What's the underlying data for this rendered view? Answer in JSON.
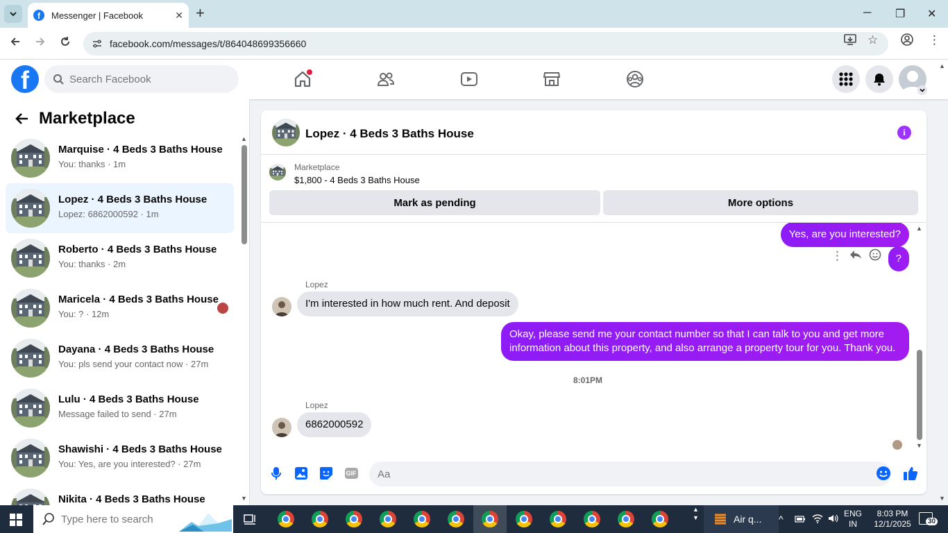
{
  "browser": {
    "tab_title": "Messenger | Facebook",
    "url": "facebook.com/messages/t/864048699356660"
  },
  "fb": {
    "search_placeholder": "Search Facebook"
  },
  "left_panel": {
    "title": "Marketplace",
    "conversations": [
      {
        "name": "Marquise · 4 Beds 3 Baths House",
        "preview": "You: thanks · 1m"
      },
      {
        "name": "Lopez · 4 Beds 3 Baths House",
        "preview": "Lopez: 6862000592 · 1m"
      },
      {
        "name": "Roberto · 4 Beds 3 Baths House",
        "preview": "You: thanks · 2m"
      },
      {
        "name": "Maricela · 4 Beds 3 Baths House",
        "preview": "You: ? · 12m"
      },
      {
        "name": "Dayana · 4 Beds 3 Baths House",
        "preview": "You: pls send your contact now · 27m"
      },
      {
        "name": "Lulu · 4 Beds 3 Baths House",
        "preview": "Message failed to send · 27m"
      },
      {
        "name": "Shawishi · 4 Beds 3 Baths House",
        "preview": "You: Yes, are you interested? · 27m"
      },
      {
        "name": "Nikita · 4 Beds 3 Baths House",
        "preview": ""
      }
    ]
  },
  "chat": {
    "title": "Lopez · 4 Beds 3 Baths House",
    "marketplace_label": "Marketplace",
    "listing": "$1,800 - 4 Beds 3 Baths House",
    "mark_pending": "Mark as pending",
    "more_options": "More options",
    "messages": {
      "out1": "Yes, are you interested?",
      "out2": "?",
      "sender1": "Lopez",
      "in1": "I'm interested in how much rent. And deposit",
      "out3": "Okay, please send me your contact number so that I can talk to you and get more information about this property, and also arrange a property tour for you. Thank you.",
      "time": "8:01PM",
      "sender2": "Lopez",
      "in2": "6862000592"
    },
    "composer_placeholder": "Aa"
  },
  "taskbar": {
    "search_placeholder": "Type here to search",
    "weather": "Air q...",
    "lang1": "ENG",
    "lang2": "IN",
    "time": "8:03 PM",
    "date": "12/1/2025",
    "notifications": "30"
  },
  "colors": {
    "fb_blue": "#1877f2",
    "messenger_purple": "#9b1cf4"
  }
}
